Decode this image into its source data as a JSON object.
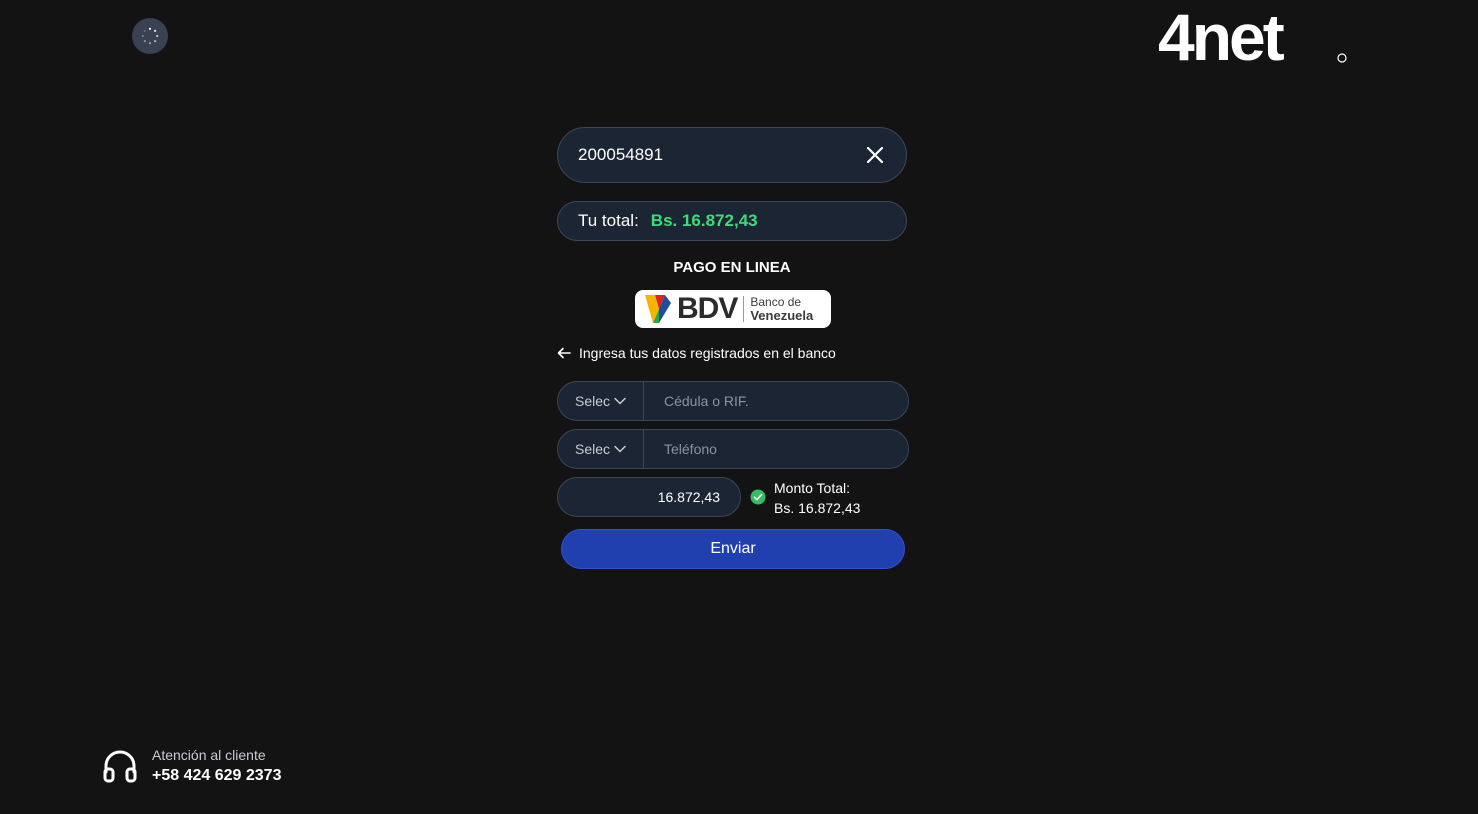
{
  "brand": {
    "logo_text": "4net"
  },
  "account": {
    "number": "200054891"
  },
  "total": {
    "label": "Tu total:",
    "amount": "Bs. 16.872,43"
  },
  "payment": {
    "section_title": "PAGO EN LINEA",
    "bank": {
      "short": "BDV",
      "line1": "Banco de",
      "line2": "Venezuela"
    },
    "instruction": "Ingresa tus datos registrados en el banco"
  },
  "form": {
    "id_selector": "Selec",
    "id_placeholder": "Cédula o RIF.",
    "phone_selector": "Selec",
    "phone_placeholder": "Teléfono",
    "amount_value": "16.872,43",
    "monto_label": "Monto Total:",
    "monto_value": "Bs. 16.872,43",
    "submit_label": "Enviar"
  },
  "support": {
    "label": "Atención al cliente",
    "phone": "+58 424 629 2373"
  },
  "colors": {
    "background": "#131314",
    "field_bg": "#1c2533",
    "accent_green": "#3ddc7a",
    "button_blue": "#2140b0"
  }
}
